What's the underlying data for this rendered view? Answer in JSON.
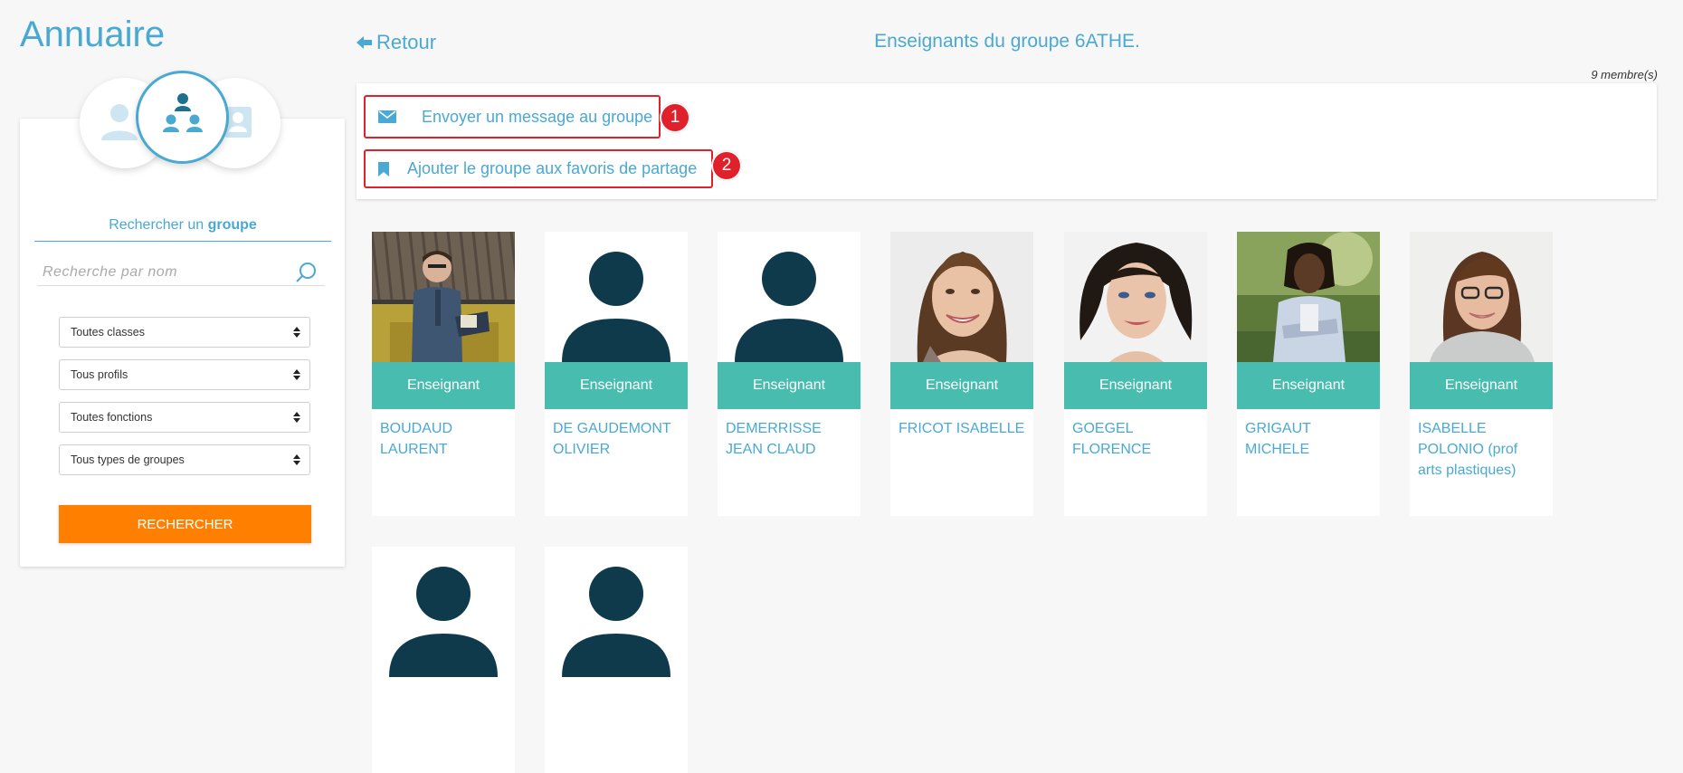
{
  "app": {
    "title": "Annuaire"
  },
  "sidebar": {
    "tabs": [
      {
        "icon": "user-icon",
        "active": false
      },
      {
        "icon": "group-icon",
        "active": true
      },
      {
        "icon": "contact-card-icon",
        "active": false
      }
    ],
    "search_title_prefix": "Rechercher un",
    "search_title_strong": "groupe",
    "search_placeholder": "Recherche par nom",
    "filters": [
      {
        "label": "Toutes classes"
      },
      {
        "label": "Tous profils"
      },
      {
        "label": "Toutes fonctions"
      },
      {
        "label": "Tous types de groupes"
      }
    ],
    "search_button": "Rechercher"
  },
  "header": {
    "back_label": "Retour",
    "page_title": "Enseignants du groupe 6ATHE.",
    "member_count": "9 membre(s)"
  },
  "actions": [
    {
      "label": "Envoyer un message au groupe",
      "icon": "envelope-icon",
      "badge": "1"
    },
    {
      "label": "Ajouter le groupe aux favoris de partage",
      "icon": "bookmark-icon",
      "badge": "2"
    }
  ],
  "members": [
    {
      "role": "Enseignant",
      "name": "BOUDAUD LAURENT",
      "photo": "photo"
    },
    {
      "role": "Enseignant",
      "name": "DE GAUDEMONT OLIVIER",
      "photo": "placeholder"
    },
    {
      "role": "Enseignant",
      "name": "DEMERRISSE JEAN CLAUD",
      "photo": "placeholder"
    },
    {
      "role": "Enseignant",
      "name": "FRICOT ISABELLE",
      "photo": "photo"
    },
    {
      "role": "Enseignant",
      "name": "GOEGEL FLORENCE",
      "photo": "photo"
    },
    {
      "role": "Enseignant",
      "name": "GRIGAUT MICHELE",
      "photo": "photo"
    },
    {
      "role": "Enseignant",
      "name": "ISABELLE POLONIO (prof arts plastiques)",
      "photo": "photo"
    },
    {
      "role": "",
      "name": "",
      "photo": "placeholder"
    },
    {
      "role": "",
      "name": "",
      "photo": "placeholder"
    }
  ],
  "colors": {
    "accent": "#4aa9d2",
    "teal": "#48bdaf",
    "orange": "#ff8000",
    "highlight_red": "#e0202a",
    "avatar_dark": "#0e3a4c"
  }
}
